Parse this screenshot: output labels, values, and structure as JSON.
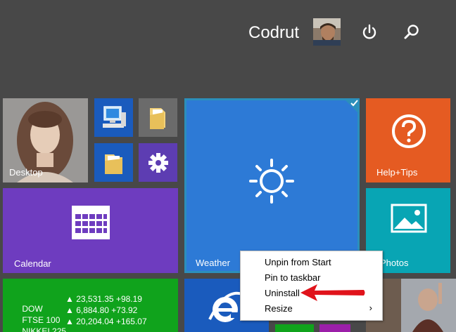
{
  "header": {
    "user_name": "Codrut",
    "power_icon": "power-icon",
    "search_icon": "search-icon"
  },
  "tiles": {
    "desktop": {
      "label": "Desktop"
    },
    "help": {
      "label": "Help+Tips"
    },
    "calendar": {
      "label": "Calendar"
    },
    "weather": {
      "label": "Weather"
    },
    "photos": {
      "label": "Photos"
    }
  },
  "stocks": {
    "rows": [
      {
        "name": "DOW",
        "value": "▲ 23,531.35 +98.19"
      },
      {
        "name": "FTSE 100",
        "value": "▲ 6,884.80 +73.92"
      },
      {
        "name": "NIKKEI 225",
        "value": "▲ 20,204.04 +165.07"
      }
    ]
  },
  "context_menu": {
    "unpin": "Unpin from Start",
    "pin_taskbar": "Pin to taskbar",
    "uninstall": "Uninstall",
    "resize": "Resize",
    "submenu_arrow": "›"
  },
  "colors": {
    "background": "#484848",
    "weather": "#2d7ad6",
    "help": "#e55b22",
    "calendar": "#6e3cbf",
    "photos": "#08a5b4",
    "finance": "#10a31c",
    "arrow": "#e0131b"
  }
}
